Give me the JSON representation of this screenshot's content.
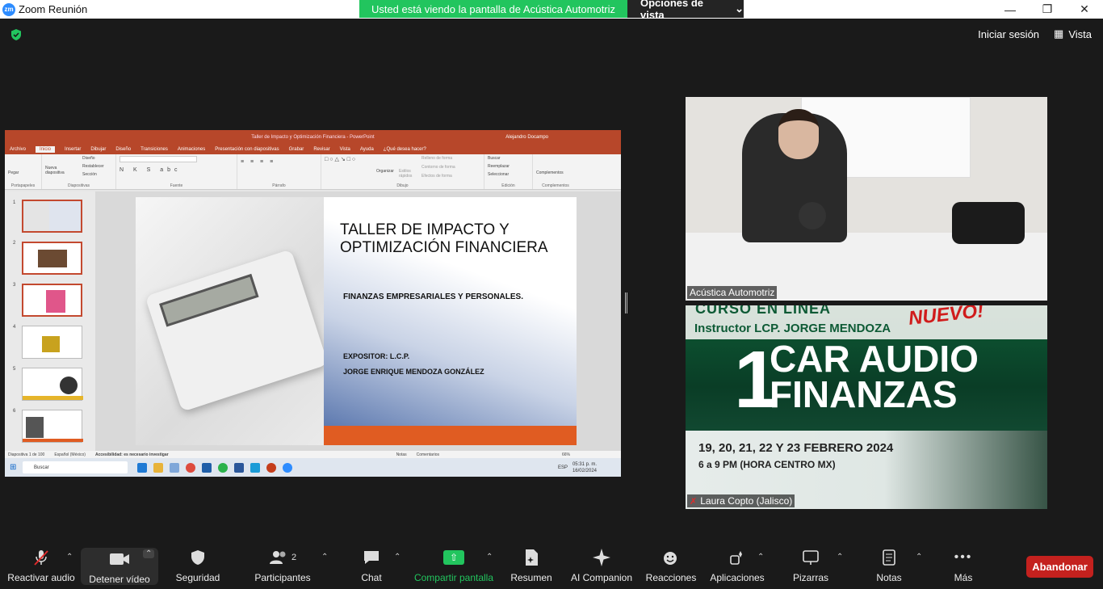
{
  "window": {
    "title": "Zoom Reunión",
    "logo": "zm"
  },
  "banner": {
    "viewing_text": "Usted está viendo la pantalla de Acústica Automotriz",
    "view_options_label": "Opciones de vista"
  },
  "top_right": {
    "sign_in": "Iniciar sesión",
    "view": "Vista"
  },
  "powerpoint": {
    "title": "Taller de Impacto y Optimización Financiera - PowerPoint",
    "user": "Alejandro Docampo",
    "tabs": [
      "Archivo",
      "Inicio",
      "Insertar",
      "Dibujar",
      "Diseño",
      "Transiciones",
      "Animaciones",
      "Presentación con diapositivas",
      "Grabar",
      "Revisar",
      "Vista",
      "Ayuda",
      "¿Qué desea hacer?"
    ],
    "ribbon_groups": [
      "Portapapeles",
      "Diapositivas",
      "Fuente",
      "Párrafo",
      "Dibujo",
      "Edición",
      "Complementos"
    ],
    "ribbon_buttons": {
      "paste": "Pegar",
      "new_slide": "Nueva diapositiva",
      "layout": "Diseño",
      "reset": "Restablecer",
      "section": "Sección",
      "arrange": "Organizar",
      "quick_styles": "Estilos rápidos",
      "shape_fill": "Relleno de forma",
      "shape_outline": "Contorno de forma",
      "shape_effects": "Efectos de forma",
      "find": "Buscar",
      "replace": "Reemplazar",
      "select": "Seleccionar",
      "addins": "Complementos"
    },
    "slide_numbers": [
      "1",
      "2",
      "3",
      "4",
      "5",
      "6"
    ],
    "slide": {
      "title": "TALLER DE IMPACTO Y OPTIMIZACIÓN FINANCIERA",
      "subtitle": "FINANZAS EMPRESARIALES Y PERSONALES.",
      "exp1": "EXPOSITOR: L.C.P.",
      "exp2": "JORGE ENRIQUE MENDOZA GONZÁLEZ"
    },
    "status": {
      "slide_of": "Diapositiva 1 de 100",
      "lang": "Español (México)",
      "accessibility": "Accesibilidad: es necesario investigar",
      "notes": "Notas",
      "comments": "Comentarios",
      "zoom": "66%"
    },
    "taskbar": {
      "search": "Buscar",
      "lang": "ESP",
      "time": "05:31 p. m.",
      "date": "16/02/2024"
    }
  },
  "tiles": {
    "tile1_name": "Acústica Automotriz",
    "tile2_name": "Laura Copto (Jalisco)",
    "ad": {
      "line1": "CURSO EN LÍNEA",
      "line2": "Instructor LCP. JORGE MENDOZA",
      "badge": "NUEVO!",
      "num": "1",
      "car": "CAR AUDIO",
      "fin": "FINANZAS",
      "dates": "19, 20, 21, 22 Y 23 FEBRERO 2024",
      "time": "6 a 9 PM (HORA CENTRO MX)"
    }
  },
  "toolbar": {
    "unmute": "Reactivar audio",
    "stop_video": "Detener vídeo",
    "security": "Seguridad",
    "participants": "Participantes",
    "participants_count": "2",
    "chat": "Chat",
    "share": "Compartir pantalla",
    "summary": "Resumen",
    "ai": "AI Companion",
    "reactions": "Reacciones",
    "apps": "Aplicaciones",
    "whiteboards": "Pizarras",
    "notes": "Notas",
    "more": "Más",
    "leave": "Abandonar"
  },
  "colors": {
    "zoom_blue": "#2d8cff",
    "share_green": "#22c55e",
    "leave_red": "#c4211e",
    "ppt_red": "#b7472a"
  }
}
